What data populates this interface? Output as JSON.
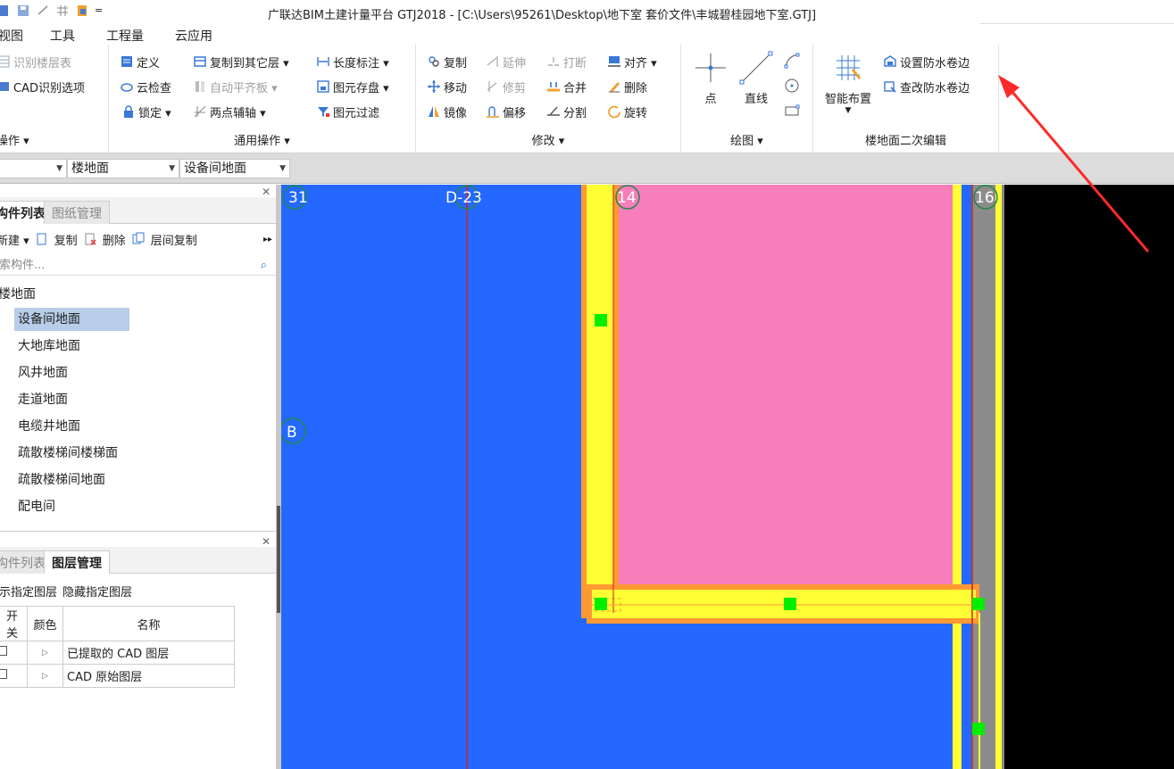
{
  "title": "广联达BIM土建计量平台 GTJ2018 - [C:\\Users\\95261\\Desktop\\地下室 套价文件\\丰城碧桂园地下室.GTJ]",
  "menu": [
    "视图",
    "工具",
    "工程量",
    "云应用"
  ],
  "ribbon": {
    "group1": {
      "items": [
        "识别楼层表",
        "CAD识别选项"
      ],
      "title": "操作 ▾"
    },
    "group2": {
      "col1": [
        "定义",
        "云检查",
        "锁定 ▾"
      ],
      "col2": [
        "复制到其它层 ▾",
        "自动平齐板 ▾",
        "两点辅轴 ▾"
      ],
      "col3": [
        "长度标注 ▾",
        "图元存盘 ▾",
        "图元过滤"
      ],
      "title": "通用操作 ▾"
    },
    "group3": {
      "col1": [
        "复制",
        "移动",
        "镜像"
      ],
      "col2": [
        "延伸",
        "修剪",
        "偏移"
      ],
      "col3": [
        "打断",
        "合并",
        "分割"
      ],
      "col4": [
        "对齐 ▾",
        "删除",
        "旋转"
      ],
      "title": "修改 ▾"
    },
    "group4": {
      "point": "点",
      "line": "直线",
      "title": "绘图 ▾"
    },
    "group5": {
      "smart": "智能布置",
      "set_waterproof": "设置防水卷边",
      "check_waterproof": "查改防水卷边",
      "title": "楼地面二次编辑"
    }
  },
  "selectors": [
    "",
    "楼地面",
    "设备间地面"
  ],
  "component_panel": {
    "tabs": [
      "构件列表",
      "图纸管理"
    ],
    "tools": [
      "新建 ▾",
      "复制",
      "删除",
      "层间复制"
    ],
    "search_placeholder": "搜索构件...",
    "root": "楼地面",
    "items": [
      "设备间地面",
      "大地库地面",
      "风井地面",
      "走道地面",
      "电缆井地面",
      "疏散楼梯间楼梯面",
      "疏散楼梯间地面",
      "配电间"
    ]
  },
  "layer_panel": {
    "tabs": [
      "构件列表",
      "图层管理"
    ],
    "tools": [
      "显示指定图层",
      "隐藏指定图层"
    ],
    "columns": [
      "开关",
      "颜色",
      "名称"
    ],
    "rows": [
      "已提取的 CAD 图层",
      "CAD 原始图层"
    ]
  },
  "canvas": {
    "axis_labels": {
      "a31": "31",
      "d23": "D-23",
      "a14": "14",
      "a16": "16",
      "b": "B"
    }
  },
  "colors": {
    "canvas_blue": "#2468ff",
    "pink": "#f77dbb",
    "yellow": "#ffff33",
    "orange": "#ff9933",
    "grip": "#00ee00",
    "annotation_arrow": "#ff2a2a"
  }
}
